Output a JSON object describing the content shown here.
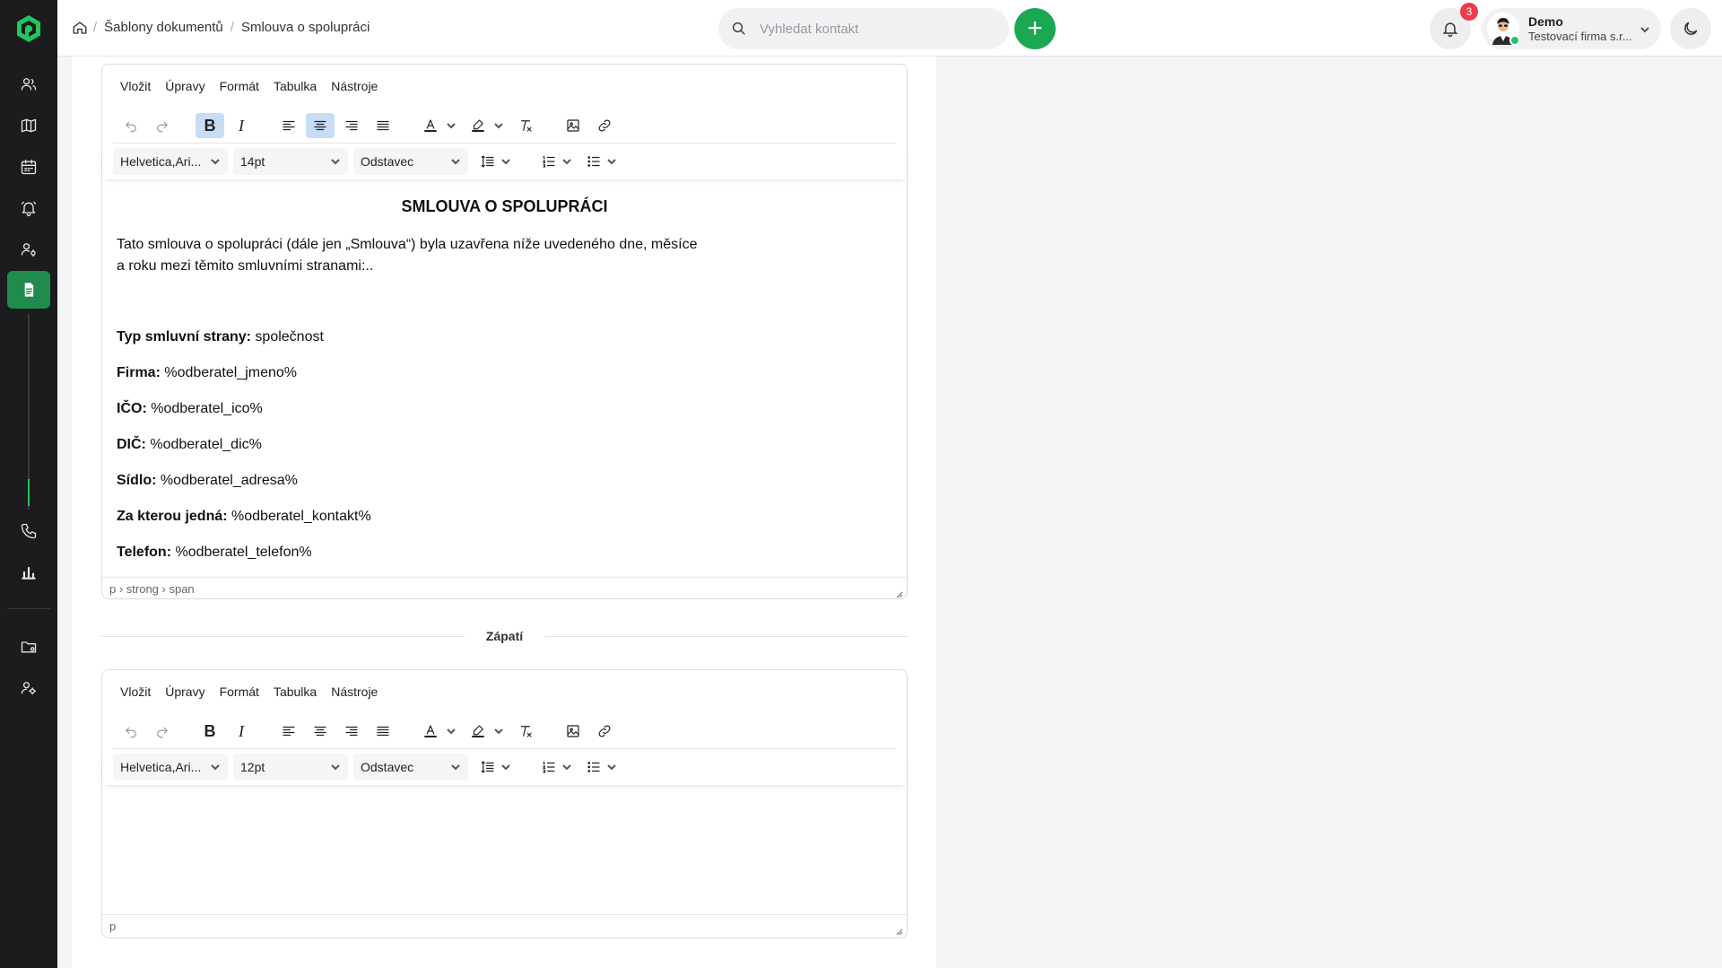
{
  "app": {
    "accent": "#1aa952",
    "sidebar_bg": "#1c1c1e"
  },
  "sidebar": {
    "items": [
      {
        "name": "contacts",
        "icon": "users-icon"
      },
      {
        "name": "map",
        "icon": "map-icon"
      },
      {
        "name": "calendar",
        "icon": "calendar-icon"
      },
      {
        "name": "reminders",
        "icon": "bell-icon"
      },
      {
        "name": "user-settings",
        "icon": "user-gear-icon"
      },
      {
        "name": "documents",
        "icon": "document-icon",
        "active": true
      },
      {
        "name": "calls",
        "icon": "phone-icon"
      },
      {
        "name": "statistics",
        "icon": "bar-chart-icon"
      },
      {
        "name": "folders",
        "icon": "folder-settings-icon"
      },
      {
        "name": "admin",
        "icon": "user-admin-icon"
      }
    ]
  },
  "header": {
    "breadcrumbs": [
      "Šablony dokumentů",
      "Smlouva o spolupráci"
    ],
    "search_placeholder": "Vyhledat kontakt",
    "add_label": "+",
    "notifications_count": "3",
    "user_name": "Demo",
    "user_company": "Testovací firma s.r..."
  },
  "editor_main": {
    "menu": [
      "Vložit",
      "Úpravy",
      "Formát",
      "Tabulka",
      "Nástroje"
    ],
    "font_family": "Helvetica,Ari...",
    "font_size": "14pt",
    "block_format": "Odstavec",
    "content": {
      "title": "SMLOUVA O SPOLUPRÁCI",
      "intro": "Tato smlouva o spolupráci (dále jen „Smlouva“) byla uzavřena níže uvedeného dne, měsíce a roku mezi těmito smluvními stranami:..",
      "fields": [
        {
          "label": "Typ smluvní strany:",
          "value": " společnost"
        },
        {
          "label": "Firma:",
          "value": " %odberatel_jmeno%"
        },
        {
          "label": "IČO:",
          "value": " %odberatel_ico%"
        },
        {
          "label": "DIČ:",
          "value": " %odberatel_dic%"
        },
        {
          "label": "Sídlo:",
          "value": " %odberatel_adresa%"
        },
        {
          "label": "Za kterou jedná:",
          "value": " %odberatel_kontakt%"
        },
        {
          "label": "Telefon:",
          "value": " %odberatel_telefon%"
        }
      ]
    },
    "status_path": "p › strong › span"
  },
  "footer_section": {
    "label": "Zápatí"
  },
  "editor_footer": {
    "menu": [
      "Vložit",
      "Úpravy",
      "Formát",
      "Tabulka",
      "Nástroje"
    ],
    "font_family": "Helvetica,Ari...",
    "font_size": "12pt",
    "block_format": "Odstavec",
    "status_path": "p"
  }
}
